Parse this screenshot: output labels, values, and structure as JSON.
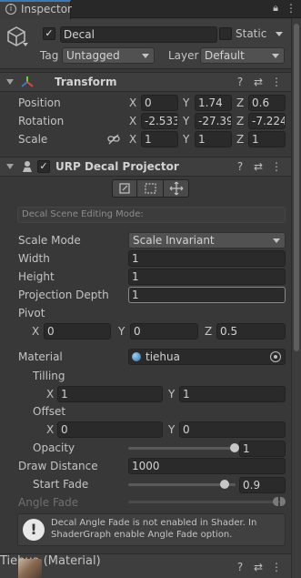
{
  "tab": {
    "title": "Inspector"
  },
  "object": {
    "name": "Decal",
    "static_label": "Static",
    "tag_label": "Tag",
    "tag_value": "Untagged",
    "layer_label": "Layer",
    "layer_value": "Default",
    "active": true,
    "is_static": false
  },
  "transform": {
    "title": "Transform",
    "rows": [
      {
        "label": "Position",
        "x": "0",
        "y": "1.74",
        "z": "0.6"
      },
      {
        "label": "Rotation",
        "x": "-2.533",
        "y": "-27.39",
        "z": "-7.224"
      },
      {
        "label": "Scale",
        "x": "1",
        "y": "1",
        "z": "1"
      }
    ],
    "axis_x": "X",
    "axis_y": "Y",
    "axis_z": "Z"
  },
  "decal": {
    "title": "URP Decal Projector",
    "enabled": true,
    "editing_mode_label": "Decal Scene Editing Mode:",
    "scale_mode_label": "Scale Mode",
    "scale_mode_value": "Scale Invariant",
    "width_label": "Width",
    "width_value": "1",
    "height_label": "Height",
    "height_value": "1",
    "projection_depth_label": "Projection Depth",
    "projection_depth_value": "1",
    "pivot_label": "Pivot",
    "pivot_x": "0",
    "pivot_y": "0",
    "pivot_z": "0.5",
    "material_label": "Material",
    "material_value": "tiehua",
    "tiling_label": "Tilling",
    "tiling_x": "1",
    "tiling_y": "1",
    "offset_label": "Offset",
    "offset_x": "0",
    "offset_y": "0",
    "opacity_label": "Opacity",
    "opacity_value": "1",
    "opacity_fraction": 1.0,
    "draw_distance_label": "Draw Distance",
    "draw_distance_value": "1000",
    "start_fade_label": "Start Fade",
    "start_fade_value": "0.9",
    "start_fade_fraction": 0.9,
    "angle_fade_label": "Angle Fade",
    "warning_text": "Decal Angle Fade is not enabled in Shader. In ShaderGraph enable Angle Fade option."
  },
  "material_section": {
    "title": "Tiehua (Material)"
  },
  "colors": {
    "bg": "#383838",
    "header": "#3e3e3e",
    "field": "#2a2a2a"
  }
}
